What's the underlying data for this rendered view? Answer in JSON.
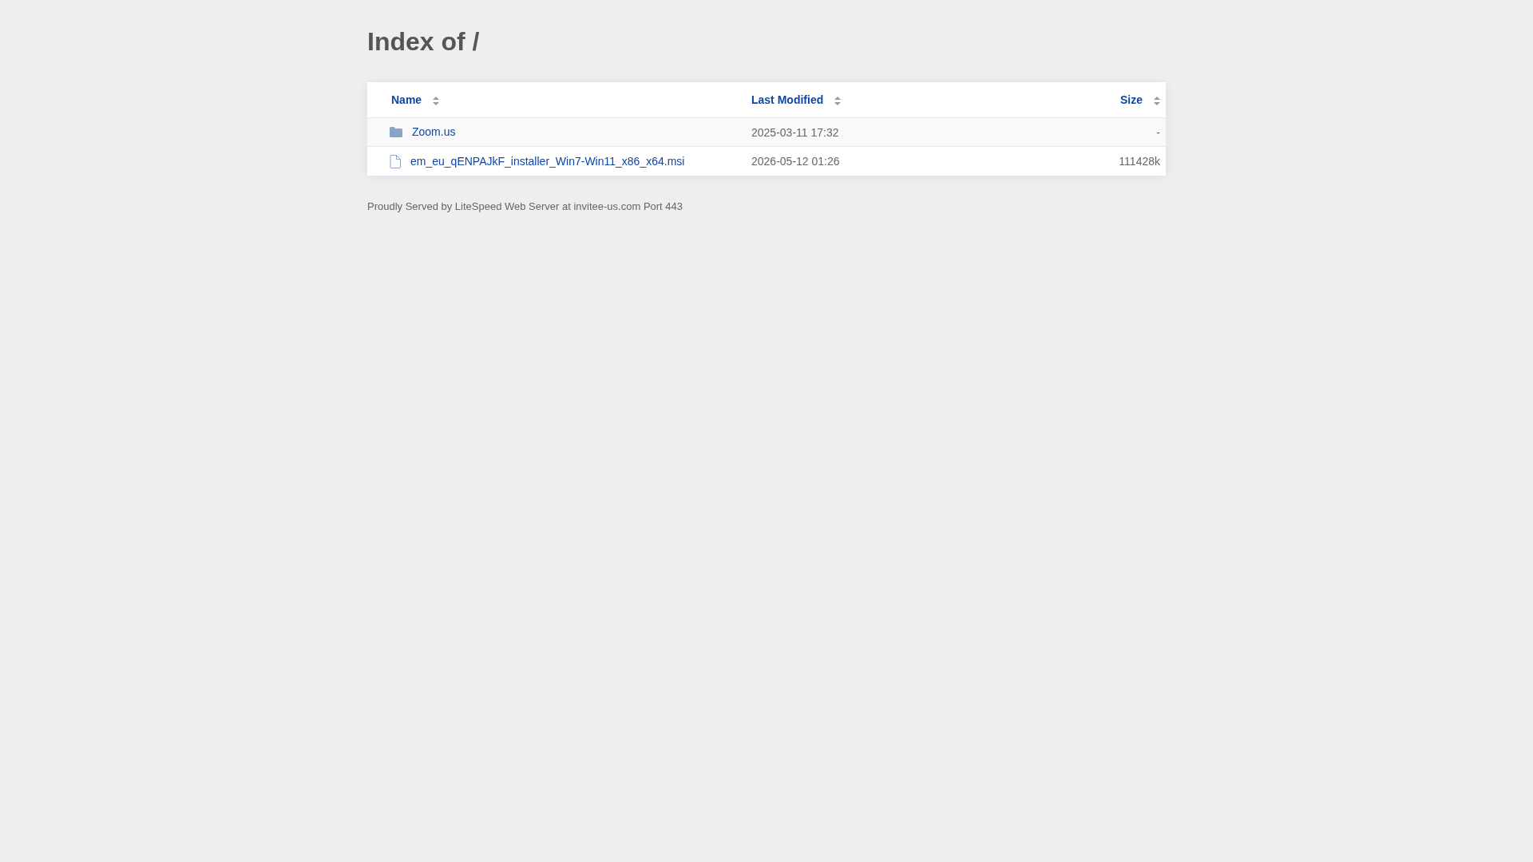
{
  "page": {
    "title": "Index of /"
  },
  "table": {
    "columns": [
      "Name",
      "Last Modified",
      "Size"
    ],
    "rows": [
      {
        "kind": "folder",
        "name": "Zoom.us",
        "modified": "2025-03-11 17:32",
        "size": "-"
      },
      {
        "kind": "file",
        "name": "em_eu_qENPAJkF_installer_Win7-Win11_x86_x64.msi",
        "modified": "2026-05-12 01:26",
        "size": "111428k"
      }
    ]
  },
  "footer": "Proudly Served by LiteSpeed Web Server at invitee-us.com Port 443"
}
